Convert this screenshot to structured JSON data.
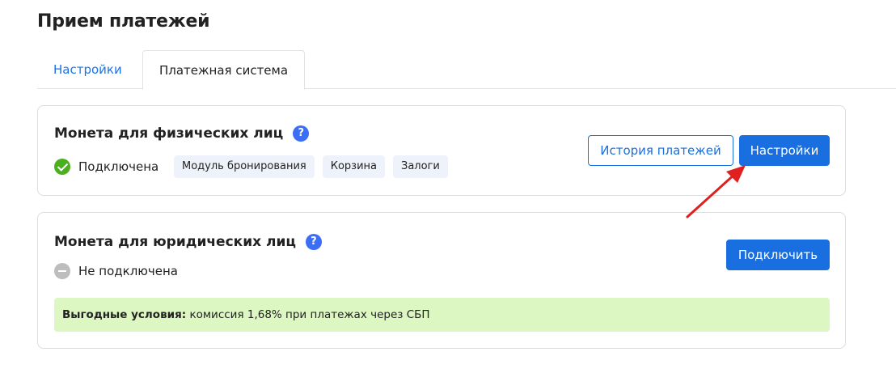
{
  "page": {
    "title": "Прием платежей"
  },
  "tabs": [
    {
      "label": "Настройки",
      "active": false
    },
    {
      "label": "Платежная система",
      "active": true
    }
  ],
  "systems": [
    {
      "title": "Монета для физических лиц",
      "status": "Подключена",
      "status_type": "connected",
      "tags": [
        "Модуль бронирования",
        "Корзина",
        "Залоги"
      ],
      "buttons": {
        "history": "История платежей",
        "settings": "Настройки"
      }
    },
    {
      "title": "Монета для юридических лиц",
      "status": "Не подключена",
      "status_type": "not-connected",
      "buttons": {
        "connect": "Подключить"
      },
      "promo": {
        "label": "Выгодные условия:",
        "text": " комиссия 1,68% при платежах через СБП"
      }
    }
  ],
  "icons": {
    "help": "?",
    "help_name": "help-question-icon",
    "ok_name": "check-circle-icon",
    "off_name": "minus-circle-icon"
  },
  "colors": {
    "accent": "#1a6fe0",
    "help": "#3b6ef5",
    "success": "#4caf1e",
    "inactive": "#bdbdbd",
    "promo_bg": "#dcf7c1",
    "annotation_arrow": "#e02020"
  }
}
